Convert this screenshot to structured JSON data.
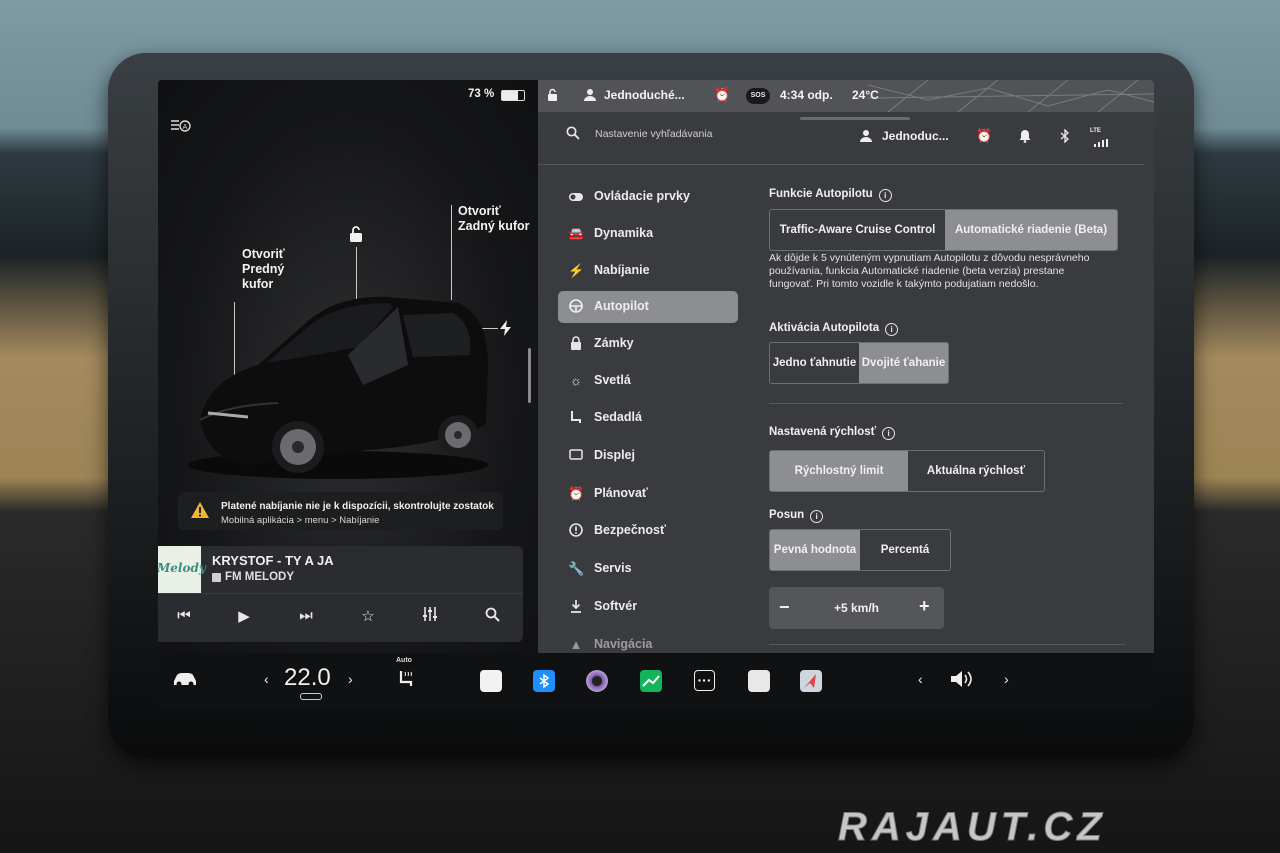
{
  "status": {
    "battery": "73 %"
  },
  "car_panel": {
    "front_trunk": [
      "Otvoriť",
      "Predný",
      "kufor"
    ],
    "rear_trunk": [
      "Otvoriť",
      "Zadný kufor"
    ]
  },
  "warning": {
    "line1": "Platené nabíjanie nie je k dispozícii, skontrolujte zostatok",
    "line2": "Mobilná aplikácia > menu > Nabíjanie"
  },
  "media": {
    "song": "KRYSTOF - TY A JA",
    "station": "FM MELODY",
    "logo_text": "Melody"
  },
  "topbar": {
    "profile": "Jednoduché...",
    "sos": "SOS",
    "time": "4:34 odp.",
    "temp": "24°C"
  },
  "search": {
    "placeholder": "Nastavenie vyhľadávania"
  },
  "header": {
    "profile": "Jednoduc...",
    "network": "LTE"
  },
  "menu": {
    "items": [
      {
        "label": "Ovládacie prvky",
        "icon": "toggle-icon"
      },
      {
        "label": "Dynamika",
        "icon": "car-icon"
      },
      {
        "label": "Nabíjanie",
        "icon": "bolt-icon"
      },
      {
        "label": "Autopilot",
        "icon": "steering-wheel-icon"
      },
      {
        "label": "Zámky",
        "icon": "lock-icon"
      },
      {
        "label": "Svetlá",
        "icon": "sun-icon"
      },
      {
        "label": "Sedadlá",
        "icon": "seat-icon"
      },
      {
        "label": "Displej",
        "icon": "display-icon"
      },
      {
        "label": "Plánovať",
        "icon": "alarm-clock-icon"
      },
      {
        "label": "Bezpečnosť",
        "icon": "alert-icon"
      },
      {
        "label": "Servis",
        "icon": "wrench-icon"
      },
      {
        "label": "Softvér",
        "icon": "download-icon"
      },
      {
        "label": "Navigácia",
        "icon": "navigation-icon"
      }
    ],
    "active_index": 3
  },
  "autopilot": {
    "features_title": "Funkcie Autopilotu",
    "features_options": [
      "Traffic-Aware Cruise Control",
      "Automatické riadenie (Beta)"
    ],
    "features_selected": 1,
    "description": "Ak dôjde k 5 vynúteným vypnutiam Autopilotu z dôvodu nesprávneho používania, funkcia Automatické riadenie (beta verzia) prestane fungovať. Pri tomto vozidle k takýmto podujatiam nedošlo.",
    "activation_title": "Aktivácia Autopilota",
    "activation_options": [
      "Jedno ťahnutie",
      "Dvojité ťahanie"
    ],
    "activation_selected": 1,
    "speed_title": "Nastavená rýchlosť",
    "speed_options": [
      "Rýchlostný limit",
      "Aktuálna rýchlosť"
    ],
    "speed_selected": 0,
    "offset_title": "Posun",
    "offset_options": [
      "Pevná hodnota",
      "Percentá"
    ],
    "offset_selected": 0,
    "offset_value": "+5 km/h"
  },
  "bottombar": {
    "temperature": "22.0",
    "seat_heat_label": "Auto"
  },
  "watermark": "RAJAUT.CZ",
  "colors": {
    "active_bg": "#8d8e91",
    "bluetooth_blue": "#1f8fff",
    "chart_green": "#16b45a"
  }
}
